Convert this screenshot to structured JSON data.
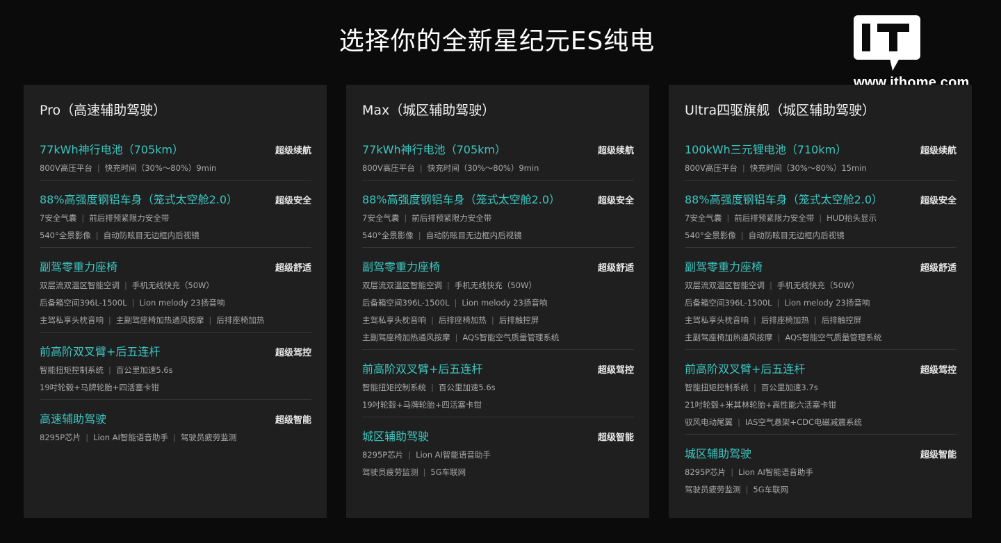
{
  "page": {
    "title": "选择你的全新星纪元ES纯电"
  },
  "logo": {
    "mark_text": "IT之家",
    "url": "www.ithome.com"
  },
  "cards": [
    {
      "title": "Pro（高速辅助驾驶）",
      "sections": [
        {
          "title": "77kWh神行电池（705km）",
          "tag": "超级续航",
          "lines": [
            [
              "800V高压平台",
              "快充时间（30%～80%）9min"
            ]
          ]
        },
        {
          "title": "88%高强度钢铝车身（笼式太空舱2.0）",
          "tag": "超级安全",
          "lines": [
            [
              "7安全气囊",
              "前后排预紧限力安全带"
            ],
            [
              "540°全景影像",
              "自动防眩目无边框内后视镜"
            ]
          ]
        },
        {
          "title": "副驾零重力座椅",
          "tag": "超级舒适",
          "lines": [
            [
              "双层流双温区智能空调",
              "手机无线快充（50W）"
            ],
            [
              "后备箱空间396L-1500L",
              "Lion melody 23扬音响"
            ],
            [
              "主驾私享头枕音响",
              "主副驾座椅加热通风按摩",
              "后排座椅加热"
            ]
          ]
        },
        {
          "title": "前高阶双叉臂+后五连杆",
          "tag": "超级驾控",
          "lines": [
            [
              "智能扭矩控制系统",
              "百公里加速5.6s"
            ],
            [
              "19吋轮毂+马牌轮胎+四活塞卡钳"
            ]
          ]
        },
        {
          "title": "高速辅助驾驶",
          "tag": "超级智能",
          "lines": [
            [
              "8295P芯片",
              "Lion AI智能语音助手",
              "驾驶员疲劳监测"
            ]
          ]
        }
      ]
    },
    {
      "title": "Max（城区辅助驾驶）",
      "sections": [
        {
          "title": "77kWh神行电池（705km）",
          "tag": "超级续航",
          "lines": [
            [
              "800V高压平台",
              "快充时间（30%～80%）9min"
            ]
          ]
        },
        {
          "title": "88%高强度钢铝车身（笼式太空舱2.0）",
          "tag": "超级安全",
          "lines": [
            [
              "7安全气囊",
              "前后排预紧限力安全带"
            ],
            [
              "540°全景影像",
              "自动防眩目无边框内后视镜"
            ]
          ]
        },
        {
          "title": "副驾零重力座椅",
          "tag": "超级舒适",
          "lines": [
            [
              "双层流双温区智能空调",
              "手机无线快充（50W）"
            ],
            [
              "后备箱空间396L-1500L",
              "Lion melody 23扬音响"
            ],
            [
              "主驾私享头枕音响",
              "后排座椅加热",
              "后排触控屏"
            ],
            [
              "主副驾座椅加热通风按摩",
              "AQS智能空气质量管理系统"
            ]
          ]
        },
        {
          "title": "前高阶双叉臂+后五连杆",
          "tag": "超级驾控",
          "lines": [
            [
              "智能扭矩控制系统",
              "百公里加速5.6s"
            ],
            [
              "19吋轮毂+马牌轮胎+四活塞卡钳"
            ]
          ]
        },
        {
          "title": "城区辅助驾驶",
          "tag": "超级智能",
          "lines": [
            [
              "8295P芯片",
              "Lion AI智能语音助手"
            ],
            [
              "驾驶员疲劳监测",
              "5G车联网"
            ]
          ]
        }
      ]
    },
    {
      "title": "Ultra四驱旗舰（城区辅助驾驶）",
      "sections": [
        {
          "title": "100kWh三元锂电池（710km）",
          "tag": "超级续航",
          "lines": [
            [
              "800V高压平台",
              "快充时间（30%～80%）15min"
            ]
          ]
        },
        {
          "title": "88%高强度钢铝车身（笼式太空舱2.0）",
          "tag": "超级安全",
          "lines": [
            [
              "7安全气囊",
              "前后排预紧限力安全带",
              "HUD抬头显示"
            ],
            [
              "540°全景影像",
              "自动防眩目无边框内后视镜"
            ]
          ]
        },
        {
          "title": "副驾零重力座椅",
          "tag": "超级舒适",
          "lines": [
            [
              "双层流双温区智能空调",
              "手机无线快充（50W）"
            ],
            [
              "后备箱空间396L-1500L",
              "Lion melody 23扬音响"
            ],
            [
              "主驾私享头枕音响",
              "后排座椅加热",
              "后排触控屏"
            ],
            [
              "主副驾座椅加热通风按摩",
              "AQS智能空气质量管理系统"
            ]
          ]
        },
        {
          "title": "前高阶双叉臂+后五连杆",
          "tag": "超级驾控",
          "lines": [
            [
              "智能扭矩控制系统",
              "百公里加速3.7s"
            ],
            [
              "21吋轮毂+米其林轮胎+高性能六活塞卡钳"
            ],
            [
              "驭风电动尾翼",
              "IAS空气悬架+CDC电磁减震系统"
            ]
          ]
        },
        {
          "title": "城区辅助驾驶",
          "tag": "超级智能",
          "lines": [
            [
              "8295P芯片",
              "Lion AI智能语音助手"
            ],
            [
              "驾驶员疲劳监测",
              "5G车联网"
            ]
          ]
        }
      ]
    }
  ]
}
